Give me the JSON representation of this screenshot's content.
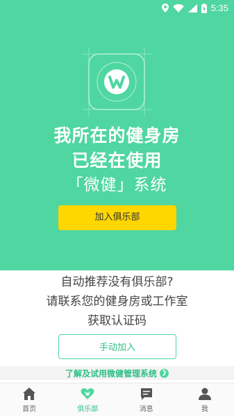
{
  "status_bar": {
    "time": "5:35"
  },
  "hero": {
    "line1": "我所在的健身房",
    "line2": "已经在使用",
    "line3": "「微健」系统",
    "join_button": "加入俱乐部"
  },
  "info": {
    "line1": "自动推荐没有俱乐部?",
    "line2": "请联系您的健身房或工作室",
    "line3": "获取认证码"
  },
  "manual_button": "手动加入",
  "learn_link": "了解及试用微健管理系统",
  "nav": {
    "items": [
      {
        "label": "首页",
        "icon": "home-icon"
      },
      {
        "label": "俱乐部",
        "icon": "club-heart-icon"
      },
      {
        "label": "消息",
        "icon": "message-icon"
      },
      {
        "label": "我",
        "icon": "person-icon"
      }
    ],
    "active_index": 1
  },
  "colors": {
    "primary": "#4fd6a1",
    "accent": "#ffd600",
    "link": "#2fbf87"
  }
}
